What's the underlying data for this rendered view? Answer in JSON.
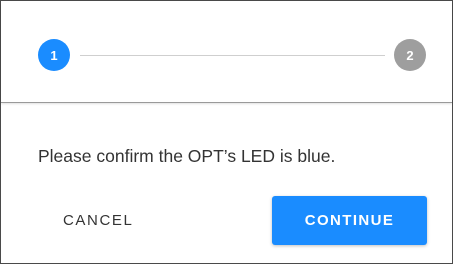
{
  "colors": {
    "accent": "#1a8cff",
    "step_inactive": "#9e9e9e",
    "connector": "#cfcfcf"
  },
  "stepper": {
    "steps": [
      {
        "label": "1",
        "state": "active"
      },
      {
        "label": "2",
        "state": "inactive"
      }
    ]
  },
  "body": {
    "message": "Please confirm the OPT’s LED is blue."
  },
  "actions": {
    "cancel_label": "CANCEL",
    "continue_label": "CONTINUE"
  }
}
